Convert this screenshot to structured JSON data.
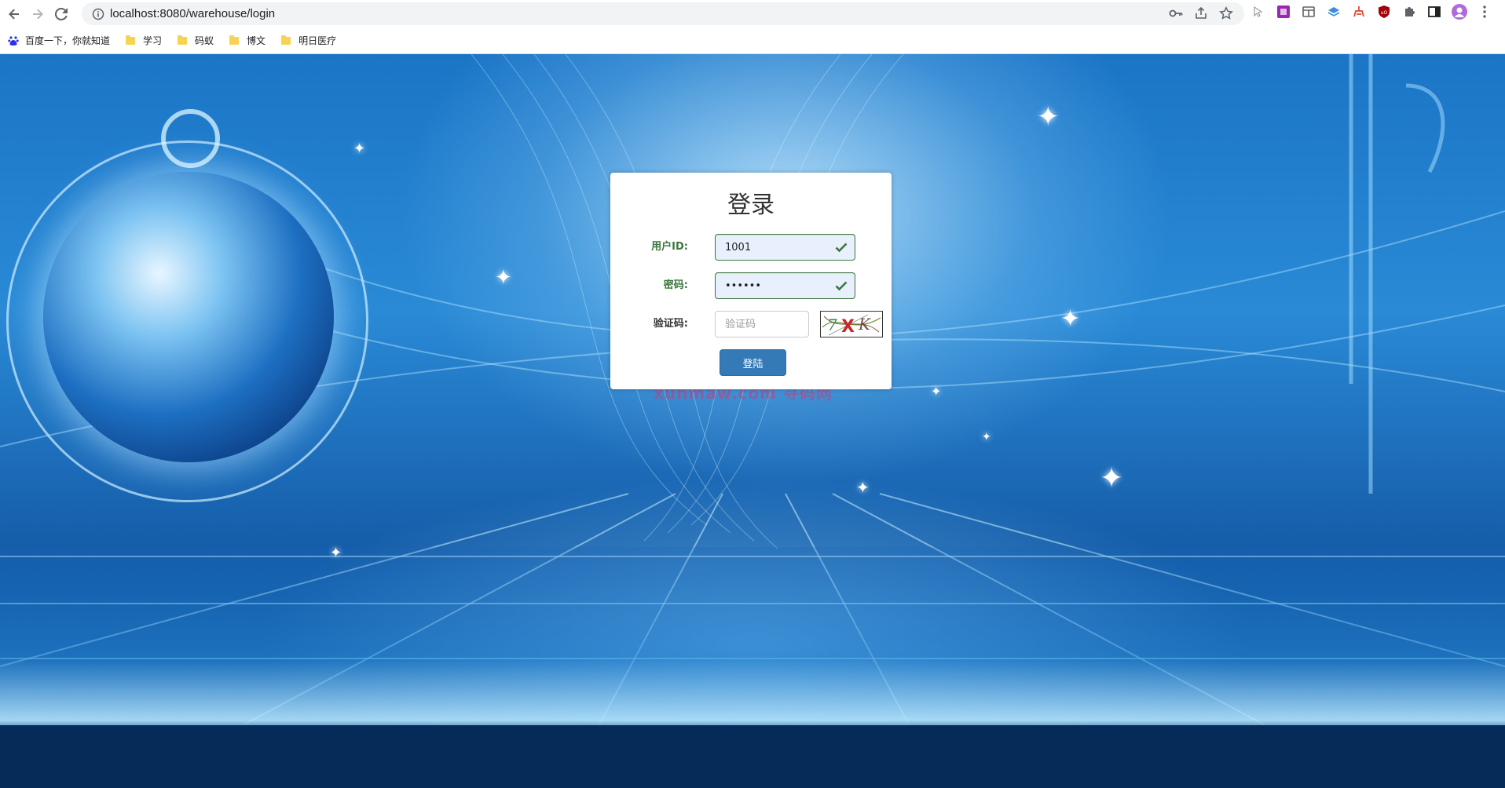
{
  "browser": {
    "url": "localhost:8080/warehouse/login",
    "bookmarks": [
      {
        "label": "百度一下，你就知道",
        "icon": "baidu-paw-icon"
      },
      {
        "label": "学习",
        "icon": "folder-icon"
      },
      {
        "label": "码蚁",
        "icon": "folder-icon"
      },
      {
        "label": "博文",
        "icon": "folder-icon"
      },
      {
        "label": "明日医疗",
        "icon": "folder-icon"
      }
    ]
  },
  "login": {
    "title": "登录",
    "user_id_label": "用户ID:",
    "user_id_value": "1001",
    "password_label": "密码:",
    "password_value": "••••••",
    "captcha_label": "验证码:",
    "captcha_placeholder": "验证码",
    "captcha_text": "7XK",
    "submit_label": "登陆"
  },
  "watermark": "xunmaw.com 寻码网",
  "colors": {
    "success": "#3c763d",
    "primary_button": "#337ab7",
    "autofill_bg": "#e8f0fe"
  }
}
